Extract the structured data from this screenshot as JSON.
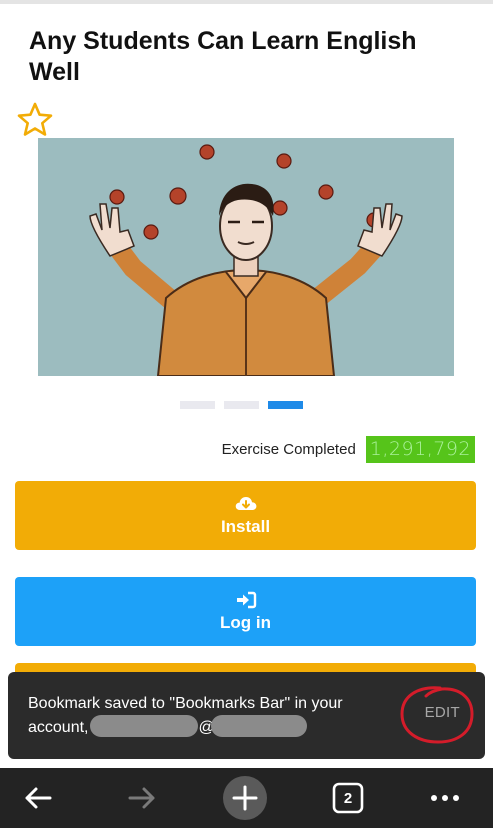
{
  "page": {
    "title": "Any Students Can Learn English Well"
  },
  "hero": {
    "icon": "juggler-illustration"
  },
  "carousel": {
    "dots": 3,
    "active_index": 2
  },
  "stats": {
    "label": "Exercise Completed",
    "value": "1,291,792"
  },
  "buttons": {
    "install": {
      "label": "Install",
      "icon": "cloud-download-icon"
    },
    "login": {
      "label": "Log in",
      "icon": "sign-in-icon"
    }
  },
  "toast": {
    "message_start": "Bookmark saved to \"Bookmarks Bar\" in your account,",
    "message_at": "@",
    "action": "EDIT"
  },
  "toolbar": {
    "tab_count": "2",
    "icons": [
      "back-arrow-icon",
      "forward-arrow-icon",
      "new-tab-icon",
      "tab-count-icon",
      "more-icon"
    ]
  },
  "colors": {
    "install": "#f2ac06",
    "login": "#1da1f8",
    "counter_bg": "#56c41a",
    "toast_bg": "#2b2b2b",
    "toolbar_bg": "#232323",
    "active_dot": "#1e8ae8",
    "annotation": "#d41c2a"
  }
}
